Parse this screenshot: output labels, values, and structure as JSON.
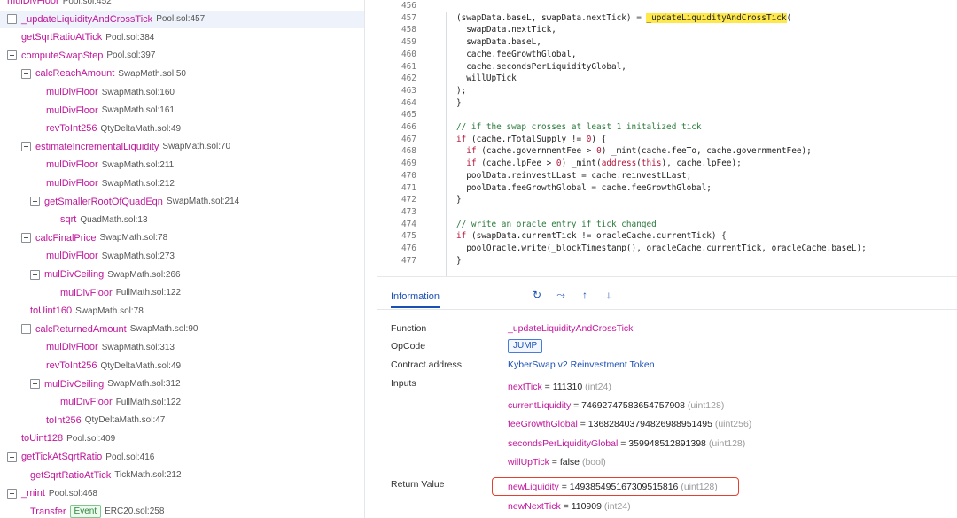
{
  "tree": [
    {
      "indent": 0,
      "toggle": "none",
      "name": "mulDivFloor",
      "loc": "Pool.sol:452",
      "event": ""
    },
    {
      "indent": 0,
      "toggle": "plus",
      "name": "_updateLiquidityAndCrossTick",
      "loc": "Pool.sol:457",
      "event": "",
      "selected": true
    },
    {
      "indent": 1,
      "toggle": "none",
      "name": "getSqrtRatioAtTick",
      "loc": "Pool.sol:384",
      "event": ""
    },
    {
      "indent": 0,
      "toggle": "minus",
      "name": "computeSwapStep",
      "loc": "Pool.sol:397",
      "event": ""
    },
    {
      "indent": 1,
      "toggle": "minus",
      "name": "calcReachAmount",
      "loc": "SwapMath.sol:50",
      "event": ""
    },
    {
      "indent": 3,
      "toggle": "none",
      "name": "mulDivFloor",
      "loc": "SwapMath.sol:160",
      "event": ""
    },
    {
      "indent": 3,
      "toggle": "none",
      "name": "mulDivFloor",
      "loc": "SwapMath.sol:161",
      "event": ""
    },
    {
      "indent": 3,
      "toggle": "none",
      "name": "revToInt256",
      "loc": "QtyDeltaMath.sol:49",
      "event": ""
    },
    {
      "indent": 1,
      "toggle": "minus",
      "name": "estimateIncrementalLiquidity",
      "loc": "SwapMath.sol:70",
      "event": ""
    },
    {
      "indent": 3,
      "toggle": "none",
      "name": "mulDivFloor",
      "loc": "SwapMath.sol:211",
      "event": ""
    },
    {
      "indent": 3,
      "toggle": "none",
      "name": "mulDivFloor",
      "loc": "SwapMath.sol:212",
      "event": ""
    },
    {
      "indent": 2,
      "toggle": "minus",
      "name": "getSmallerRootOfQuadEqn",
      "loc": "SwapMath.sol:214",
      "event": ""
    },
    {
      "indent": 4,
      "toggle": "none",
      "name": "sqrt",
      "loc": "QuadMath.sol:13",
      "event": ""
    },
    {
      "indent": 1,
      "toggle": "minus",
      "name": "calcFinalPrice",
      "loc": "SwapMath.sol:78",
      "event": ""
    },
    {
      "indent": 3,
      "toggle": "none",
      "name": "mulDivFloor",
      "loc": "SwapMath.sol:273",
      "event": ""
    },
    {
      "indent": 2,
      "toggle": "minus",
      "name": "mulDivCeiling",
      "loc": "SwapMath.sol:266",
      "event": ""
    },
    {
      "indent": 4,
      "toggle": "none",
      "name": "mulDivFloor",
      "loc": "FullMath.sol:122",
      "event": ""
    },
    {
      "indent": 2,
      "toggle": "none",
      "name": "toUint160",
      "loc": "SwapMath.sol:78",
      "event": ""
    },
    {
      "indent": 1,
      "toggle": "minus",
      "name": "calcReturnedAmount",
      "loc": "SwapMath.sol:90",
      "event": ""
    },
    {
      "indent": 3,
      "toggle": "none",
      "name": "mulDivFloor",
      "loc": "SwapMath.sol:313",
      "event": ""
    },
    {
      "indent": 3,
      "toggle": "none",
      "name": "revToInt256",
      "loc": "QtyDeltaMath.sol:49",
      "event": ""
    },
    {
      "indent": 2,
      "toggle": "minus",
      "name": "mulDivCeiling",
      "loc": "SwapMath.sol:312",
      "event": ""
    },
    {
      "indent": 4,
      "toggle": "none",
      "name": "mulDivFloor",
      "loc": "FullMath.sol:122",
      "event": ""
    },
    {
      "indent": 3,
      "toggle": "none",
      "name": "toInt256",
      "loc": "QtyDeltaMath.sol:47",
      "event": ""
    },
    {
      "indent": 1,
      "toggle": "none",
      "name": "toUint128",
      "loc": "Pool.sol:409",
      "event": ""
    },
    {
      "indent": 0,
      "toggle": "minus",
      "name": "getTickAtSqrtRatio",
      "loc": "Pool.sol:416",
      "event": ""
    },
    {
      "indent": 2,
      "toggle": "none",
      "name": "getSqrtRatioAtTick",
      "loc": "TickMath.sol:212",
      "event": ""
    },
    {
      "indent": 0,
      "toggle": "minus",
      "name": "_mint",
      "loc": "Pool.sol:468",
      "event": ""
    },
    {
      "indent": 2,
      "toggle": "none",
      "name": "Transfer",
      "loc": "ERC20.sol:258",
      "event": "Event"
    }
  ],
  "code": [
    {
      "ln": "456",
      "segs": [
        {
          "t": "",
          "c": ""
        }
      ]
    },
    {
      "ln": "457",
      "segs": [
        {
          "t": "(swapData.baseL, swapData.nextTick) = ",
          "c": ""
        },
        {
          "t": "_updateLiquidityAndCrossTick",
          "c": "hl"
        },
        {
          "t": "(",
          "c": ""
        }
      ]
    },
    {
      "ln": "458",
      "segs": [
        {
          "t": "  swapData.nextTick,",
          "c": ""
        }
      ]
    },
    {
      "ln": "459",
      "segs": [
        {
          "t": "  swapData.baseL,",
          "c": ""
        }
      ]
    },
    {
      "ln": "460",
      "segs": [
        {
          "t": "  cache.feeGrowthGlobal,",
          "c": ""
        }
      ]
    },
    {
      "ln": "461",
      "segs": [
        {
          "t": "  cache.secondsPerLiquidityGlobal,",
          "c": ""
        }
      ]
    },
    {
      "ln": "462",
      "segs": [
        {
          "t": "  willUpTick",
          "c": ""
        }
      ]
    },
    {
      "ln": "463",
      "segs": [
        {
          "t": ");",
          "c": ""
        }
      ]
    },
    {
      "ln": "464",
      "segs": [
        {
          "t": "}",
          "c": ""
        }
      ]
    },
    {
      "ln": "465",
      "segs": [
        {
          "t": "",
          "c": ""
        }
      ]
    },
    {
      "ln": "466",
      "segs": [
        {
          "t": "// if the swap crosses at least 1 initalized tick",
          "c": "cm"
        }
      ]
    },
    {
      "ln": "467",
      "segs": [
        {
          "t": "if",
          "c": "kw"
        },
        {
          "t": " (cache.rTotalSupply != ",
          "c": ""
        },
        {
          "t": "0",
          "c": "kw"
        },
        {
          "t": ") {",
          "c": ""
        }
      ]
    },
    {
      "ln": "468",
      "segs": [
        {
          "t": "  ",
          "c": ""
        },
        {
          "t": "if",
          "c": "kw"
        },
        {
          "t": " (cache.governmentFee > ",
          "c": ""
        },
        {
          "t": "0",
          "c": "kw"
        },
        {
          "t": ") _mint(cache.feeTo, cache.governmentFee);",
          "c": ""
        }
      ]
    },
    {
      "ln": "469",
      "segs": [
        {
          "t": "  ",
          "c": ""
        },
        {
          "t": "if",
          "c": "kw"
        },
        {
          "t": " (cache.lpFee > ",
          "c": ""
        },
        {
          "t": "0",
          "c": "kw"
        },
        {
          "t": ") _mint(",
          "c": ""
        },
        {
          "t": "address",
          "c": "kw"
        },
        {
          "t": "(",
          "c": ""
        },
        {
          "t": "this",
          "c": "kw"
        },
        {
          "t": "), cache.lpFee);",
          "c": ""
        }
      ]
    },
    {
      "ln": "470",
      "segs": [
        {
          "t": "  poolData.reinvestLLast = cache.reinvestLLast;",
          "c": ""
        }
      ]
    },
    {
      "ln": "471",
      "segs": [
        {
          "t": "  poolData.feeGrowthGlobal = cache.feeGrowthGlobal;",
          "c": ""
        }
      ]
    },
    {
      "ln": "472",
      "segs": [
        {
          "t": "}",
          "c": ""
        }
      ]
    },
    {
      "ln": "473",
      "segs": [
        {
          "t": "",
          "c": ""
        }
      ]
    },
    {
      "ln": "474",
      "segs": [
        {
          "t": "// write an oracle entry if tick changed",
          "c": "cm"
        }
      ]
    },
    {
      "ln": "475",
      "segs": [
        {
          "t": "if",
          "c": "kw"
        },
        {
          "t": " (swapData.currentTick != oracleCache.currentTick) {",
          "c": ""
        }
      ]
    },
    {
      "ln": "476",
      "segs": [
        {
          "t": "  poolOracle.write(_blockTimestamp(), oracleCache.currentTick, oracleCache.baseL);",
          "c": ""
        }
      ]
    },
    {
      "ln": "477",
      "segs": [
        {
          "t": "}",
          "c": ""
        }
      ]
    }
  ],
  "info": {
    "tab_label": "Information",
    "icons": [
      "step-over-icon",
      "step-return-icon",
      "step-up-icon",
      "step-down-icon"
    ],
    "function_label": "Function",
    "function_value": "_updateLiquidityAndCrossTick",
    "opcode_label": "OpCode",
    "opcode_value": "JUMP",
    "contract_label": "Contract.address",
    "contract_value": "KyberSwap v2 Reinvestment Token",
    "inputs_label": "Inputs",
    "inputs": [
      {
        "name": "nextTick",
        "value": "111310",
        "type": "(int24)"
      },
      {
        "name": "currentLiquidity",
        "value": "74692747583654757908",
        "type": "(uint128)"
      },
      {
        "name": "feeGrowthGlobal",
        "value": "1368284037948269889514​95",
        "type": "(uint256)"
      },
      {
        "name": "secondsPerLiquidityGlobal",
        "value": "359948512891398",
        "type": "(uint128)"
      },
      {
        "name": "willUpTick",
        "value": "false",
        "type": "(bool)"
      }
    ],
    "return_label": "Return Value",
    "returns": [
      {
        "name": "newLiquidity",
        "value": "149385495167309515816",
        "type": "(uint128)"
      },
      {
        "name": "newNextTick",
        "value": "110909",
        "type": "(int24)"
      }
    ]
  }
}
